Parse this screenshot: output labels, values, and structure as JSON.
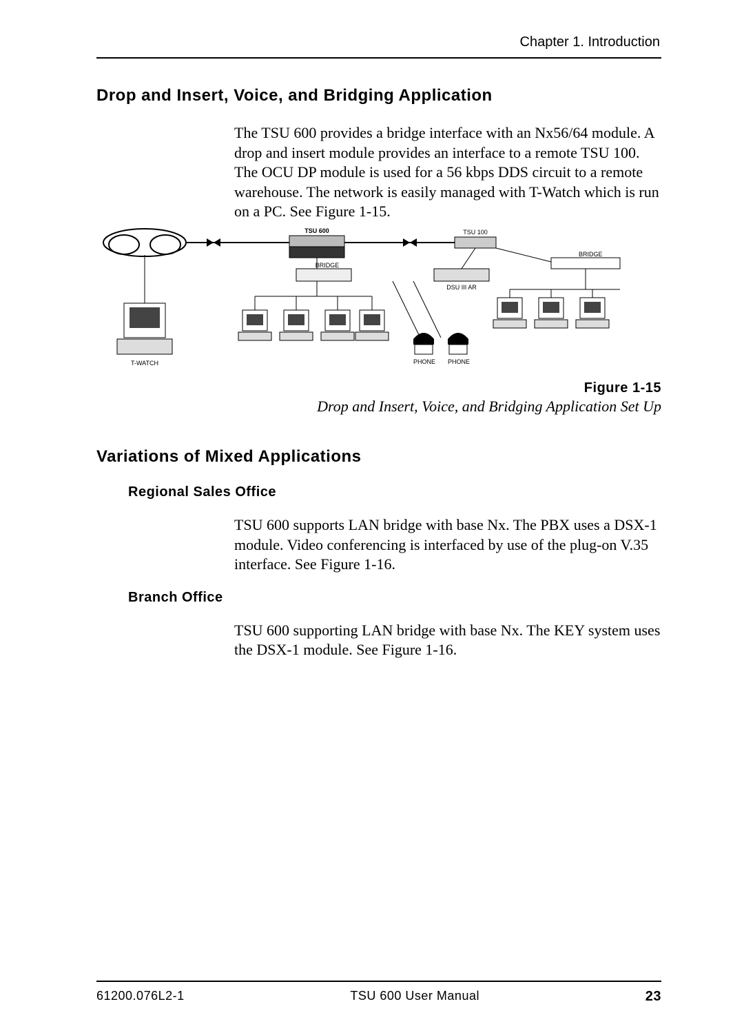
{
  "header": {
    "running": "Chapter 1.  Introduction"
  },
  "section1": {
    "heading": "Drop and Insert, Voice, and Bridging Application",
    "paragraph": "The TSU 600 provides a bridge interface with an Nx56/64 module.  A drop and insert module provides an interface to a remote TSU 100.  The OCU DP module is used for a 56 kbps DDS circuit to a remote warehouse.  The network is easily managed with T-Watch which is run on a PC.  See Figure 1-15."
  },
  "figure": {
    "labels": {
      "tsu600": "TSU 600",
      "tsu100": "TSU 100",
      "bridge": "BRIDGE",
      "dsuiiiar": "DSU III AR",
      "twatch": "T-WATCH",
      "phone": "PHONE"
    },
    "caption_no": "Figure 1-15",
    "caption": "Drop and Insert, Voice, and Bridging Application Set Up"
  },
  "section2": {
    "heading": "Variations of Mixed Applications",
    "sub1": "Regional Sales Office",
    "para1": "TSU 600 supports LAN bridge with base Nx.  The PBX uses a DSX-1 module.  Video conferencing is inter­faced by use of the plug-on V.35 interface.  See Figure 1-16.",
    "sub2": "Branch Office",
    "para2": "TSU 600 supporting LAN bridge with base Nx.  The KEY system uses the DSX-1 module.  See Figure 1-16."
  },
  "footer": {
    "left": "61200.076L2-1",
    "center": "TSU 600 User Manual",
    "page": "23"
  }
}
